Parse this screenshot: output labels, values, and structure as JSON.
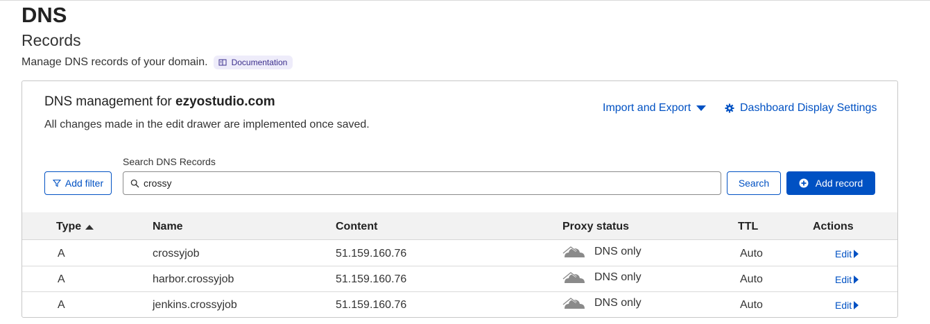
{
  "page": {
    "title": "DNS",
    "subtitle": "Records",
    "description": "Manage DNS records of your domain.",
    "doc_badge": "Documentation"
  },
  "management": {
    "title_prefix": "DNS management for",
    "domain": "ezyostudio.com",
    "subtitle": "All changes made in the edit drawer are implemented once saved.",
    "import_export": "Import and Export",
    "display_settings": "Dashboard Display Settings"
  },
  "search": {
    "label": "Search DNS Records",
    "value": "crossy",
    "add_filter": "Add filter",
    "search_button": "Search",
    "add_record": "Add record"
  },
  "table": {
    "headers": {
      "type": "Type",
      "name": "Name",
      "content": "Content",
      "proxy": "Proxy status",
      "ttl": "TTL",
      "actions": "Actions"
    },
    "rows": [
      {
        "type": "A",
        "name": "crossyjob",
        "content": "51.159.160.76",
        "proxy": "DNS only",
        "ttl": "Auto",
        "action": "Edit"
      },
      {
        "type": "A",
        "name": "harbor.crossyjob",
        "content": "51.159.160.76",
        "proxy": "DNS only",
        "ttl": "Auto",
        "action": "Edit"
      },
      {
        "type": "A",
        "name": "jenkins.crossyjob",
        "content": "51.159.160.76",
        "proxy": "DNS only",
        "ttl": "Auto",
        "action": "Edit"
      }
    ]
  },
  "colors": {
    "accent": "#0051c3",
    "badge_bg": "#eeecfa",
    "header_bg": "#f2f2f2",
    "cloud": "#8a8a8a"
  },
  "icons": {
    "doc": "book-icon",
    "caret": "caret-down-icon",
    "settings": "gear-icon",
    "filter": "filter-icon",
    "search": "search-icon",
    "add": "plus-circle-icon",
    "sort": "sort-asc-icon",
    "cloud": "dns-only-cloud-icon",
    "edit": "caret-right-icon"
  }
}
